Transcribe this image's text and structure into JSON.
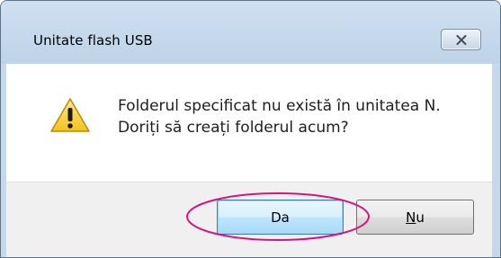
{
  "dialog": {
    "title": "Unitate flash USB",
    "close_icon": "close-x-icon",
    "warning_icon": "warning-triangle-icon",
    "message_line1": "Folderul specificat nu există în unitatea N.",
    "message_line2": "Doriți să creați folderul acum?",
    "yes_label": "Da",
    "no_label_mnemonic": "N",
    "no_label_rest": "u"
  },
  "annotation": {
    "color": "#d4157b"
  }
}
